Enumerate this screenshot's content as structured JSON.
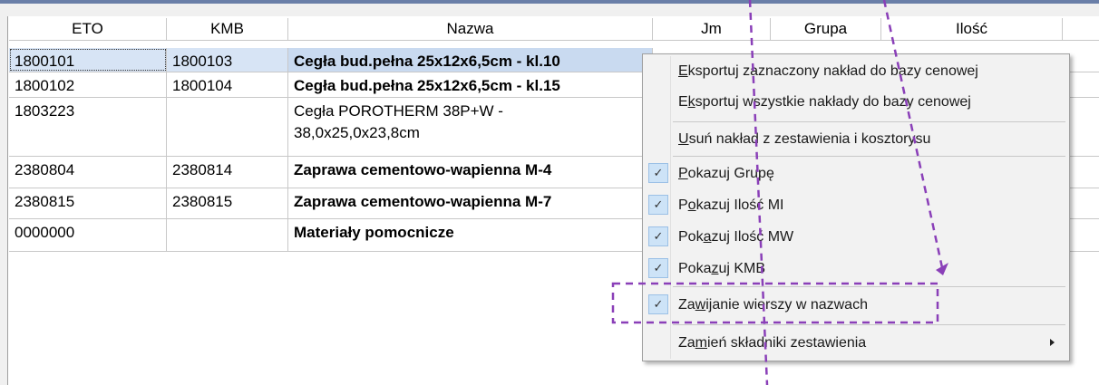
{
  "columns": [
    "ETO",
    "KMB",
    "Nazwa",
    "Jm",
    "Grupa",
    "Ilość"
  ],
  "rows": [
    {
      "eto": "1800101",
      "kmb": "1800103",
      "nazwa": "Cegła bud.pełna 25x12x6,5cm - kl.10",
      "nazwa2": ""
    },
    {
      "eto": "1800102",
      "kmb": "1800104",
      "nazwa": "Cegła bud.pełna 25x12x6,5cm - kl.15",
      "nazwa2": ""
    },
    {
      "eto": "1803223",
      "kmb": "",
      "nazwa": "Cegła POROTHERM 38P+W -",
      "nazwa2": "38,0x25,0x23,8cm"
    },
    {
      "eto": "2380804",
      "kmb": "2380814",
      "nazwa": "Zaprawa cementowo-wapienna M-4",
      "nazwa2": ""
    },
    {
      "eto": "2380815",
      "kmb": "2380815",
      "nazwa": "Zaprawa cementowo-wapienna M-7",
      "nazwa2": ""
    },
    {
      "eto": "0000000",
      "kmb": "",
      "nazwa": "Materiały pomocnicze",
      "nazwa2": ""
    }
  ],
  "menu": {
    "items": [
      {
        "pre": "",
        "u": "E",
        "post": "ksportuj zaznaczony nakład do bazy cenowej",
        "checked": false
      },
      {
        "pre": "E",
        "u": "k",
        "post": "sportuj wszystkie nakłady do bazy cenowej",
        "checked": false
      },
      {
        "pre": "",
        "u": "U",
        "post": "suń nakład z zestawienia i kosztorysu",
        "checked": false
      },
      {
        "pre": "",
        "u": "P",
        "post": "okazuj Grupę",
        "checked": true
      },
      {
        "pre": "P",
        "u": "o",
        "post": "kazuj Ilość MI",
        "checked": true
      },
      {
        "pre": "Pok",
        "u": "a",
        "post": "zuj Ilość MW",
        "checked": true
      },
      {
        "pre": "Poka",
        "u": "z",
        "post": "uj KMB",
        "checked": true
      },
      {
        "pre": "Za",
        "u": "w",
        "post": "ijanie wierszy w nazwach",
        "checked": true
      },
      {
        "pre": "Za",
        "u": "m",
        "post": "ień składniki zestawienia",
        "checked": false
      }
    ]
  },
  "colors": {
    "highlight": "#8a3fb8",
    "selection": "#d7e4f5",
    "check_bg": "#cde3f7"
  },
  "icons": {
    "check": "checkmark-icon",
    "submenu": "submenu-arrow-icon"
  }
}
